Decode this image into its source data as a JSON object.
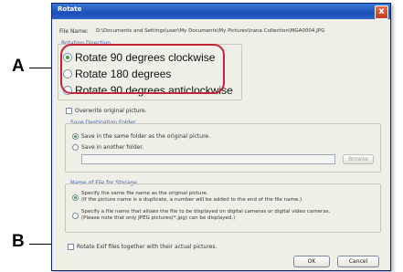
{
  "dialog": {
    "title": "Rotate",
    "close_glyph": "x",
    "file_name_label": "File Name:",
    "file_path": "D:\\Documents and Settings\\user\\My Documents\\My Pictures\\Irana Collection\\MGA0004.JPG",
    "rotation_group_label": "Rotation Direction",
    "rotation_options": [
      {
        "label": "Rotate 90 degrees clockwise",
        "selected": true
      },
      {
        "label": "Rotate 180 degrees",
        "selected": false
      },
      {
        "label": "Rotate 90 degrees anticlockwise",
        "selected": false
      }
    ],
    "overwrite_label": "Overwrite original picture.",
    "save_destination_label": "Save Destination Folder",
    "save_options": [
      {
        "label": "Save in the same folder as the original picture.",
        "selected": true
      },
      {
        "label": "Save in another folder.",
        "selected": false
      }
    ],
    "browse_label": "Browse",
    "storage_name_label": "Name of File for Storage",
    "storage_options": [
      {
        "line1": "Specify the same file name as the original picture.",
        "line2": "(If the picture name is a duplicate, a number will be added to the end of the file name.)",
        "selected": true
      },
      {
        "line1": "Specify a file name that allows the file to be displayed on digital cameras or digital video cameras.",
        "line2": "(Please note that only JPEG pictures(*.jpg) can be displayed.)",
        "selected": false
      }
    ],
    "exif_label": "Rotate Exif files together with their actual pictures.",
    "ok_label": "OK",
    "cancel_label": "Cancel"
  },
  "annotations": {
    "a": "A",
    "b": "B",
    "highlight_color": "#c3243a"
  }
}
